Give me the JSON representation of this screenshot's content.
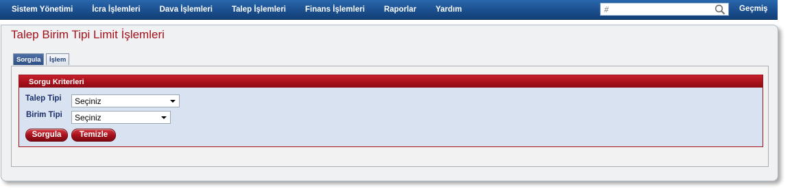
{
  "nav": {
    "items": [
      {
        "label": "Sistem Yönetimi"
      },
      {
        "label": "İcra İşlemleri"
      },
      {
        "label": "Dava İşlemleri"
      },
      {
        "label": "Talep İşlemleri"
      },
      {
        "label": "Finans İşlemleri"
      },
      {
        "label": "Raporlar"
      },
      {
        "label": "Yardım"
      }
    ],
    "search": {
      "placeholder": "#",
      "value": ""
    },
    "history_label": "Geçmiş"
  },
  "page": {
    "title": "Talep Birim Tipi Limit İşlemleri"
  },
  "tabs": [
    {
      "label": "Sorgula",
      "active": true
    },
    {
      "label": "İşlem",
      "active": false
    }
  ],
  "criteria": {
    "header": "Sorgu Kriterleri",
    "fields": [
      {
        "label": "Talep Tipi",
        "selected": "Seçiniz"
      },
      {
        "label": "Birim Tipi",
        "selected": "Seçiniz"
      }
    ],
    "buttons": {
      "query": "Sorgula",
      "clear": "Temizle"
    }
  },
  "colors": {
    "nav_bg": "#1b4f8e",
    "title_red": "#a3101a",
    "criteria_bg": "#d9e2f0",
    "label_blue": "#1a2f6b"
  },
  "icons": {
    "search": "magnifier-icon",
    "caret": "chevron-down-icon"
  }
}
